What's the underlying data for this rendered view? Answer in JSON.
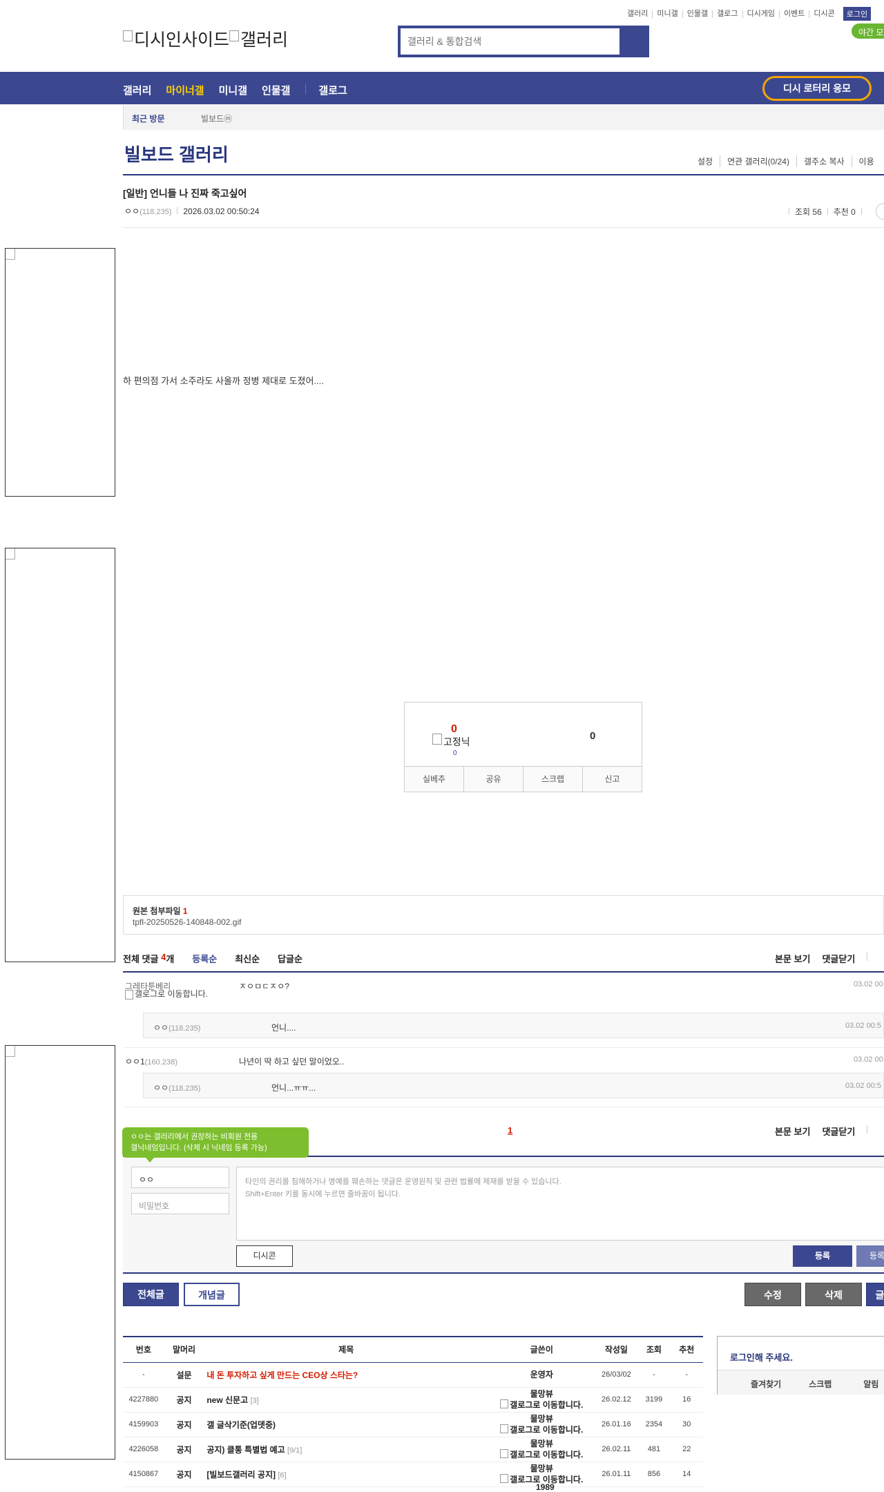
{
  "util_nav": [
    "갤러리",
    "미니갤",
    "인물갤",
    "갤로그",
    "디시게임",
    "이벤트",
    "디시콘"
  ],
  "login_label": "로그인",
  "night_mode_label": "야간 모",
  "logo_alt": "디시인사이드",
  "logo_gallery_alt": "갤러리",
  "search_placeholder": "갤러리 & 통합검색",
  "gnb": [
    "갤러리",
    "마이너갤",
    "미니갤",
    "인물갤"
  ],
  "gnb_gallog": "갤로그",
  "lotto_label": "디시 로터리 응모",
  "recent_visit_label": "최근 방문",
  "recent_gallery": "빌보드ⓜ",
  "gallery_title": "빌보드 갤러리",
  "gallery_menu": [
    "설정",
    "연관 갤러리(0/24)",
    "갤주소 복사",
    "이용"
  ],
  "post": {
    "title": "[일반] 언니들 나 진짜 죽고싶어",
    "writer": "ㅇㅇ",
    "writer_ip": "(118.235)",
    "date": "2026.03.02 00:50:24",
    "views": "조회 56",
    "recommend": "추천 0",
    "body": "하 편의점 가서 소주라도 사올까 정병 제대로 도졌어...."
  },
  "recommend_box": {
    "up": "0",
    "fixed_alt": "고정닉",
    "fixed_count": "0",
    "down": "0",
    "buttons": [
      "실베추",
      "공유",
      "스크랩",
      "신고"
    ]
  },
  "attachment": {
    "label": "원본 첨부파일",
    "count": "1",
    "file": "tpfl-20250526-140848-002.gif"
  },
  "comments_header": {
    "total_label": "전체 댓글",
    "count": "4",
    "unit": "개",
    "sort": [
      "등록순",
      "최신순",
      "답글순"
    ],
    "right": [
      "본문 보기",
      "댓글닫기"
    ]
  },
  "comments": [
    {
      "nick": "그레타툰베리",
      "gallog_alt": "갤로그로 이동합니다.",
      "text": "ㅈㅇㅁㄷㅈㅇ?",
      "date": "03.02 00"
    },
    {
      "nick": "ㅇㅇ",
      "ip": "(118.235)",
      "text": "언니....",
      "date": "03.02 00:5",
      "reply": true
    },
    {
      "nick": "ㅇㅇ1",
      "ip": "(160.238)",
      "text": "나년이 딱 하고 싶던 말이었오..",
      "date": "03.02 00"
    },
    {
      "nick": "ㅇㅇ",
      "ip": "(118.235)",
      "text": "언니...ㅠㅠ...",
      "date": "03.02 00:5",
      "reply": true
    }
  ],
  "page_number": "1",
  "write": {
    "tip": "ㅇㅇ는 갤러리에서 권장하는 비회원 전용\n갤닉네임입니다. (삭제 시 닉네임 등록 가능)",
    "name_value": "ㅇㅇ",
    "password_placeholder": "비밀번호",
    "textarea_placeholder": "타인의 권리를 침해하거나 명예를 훼손하는 댓글은 운영원칙 및 관련 법률에 제재를 받을 수 있습니다.\nShift+Enter 키를 동시에 누르면 줄바꿈이 됩니다.",
    "dccon_label": "디시콘",
    "submit_label": "등록",
    "submit2_label": "등록"
  },
  "list_tabs": [
    "전체글",
    "개념글"
  ],
  "action_buttons": [
    "수정",
    "삭제",
    "글"
  ],
  "table": {
    "headers": [
      "번호",
      "말머리",
      "제목",
      "글쓴이",
      "작성일",
      "조회",
      "추천"
    ],
    "rows": [
      {
        "no": "-",
        "head": "설문",
        "title": "내 돈 투자하고 싶게 만드는 CEO상 스타는?",
        "cnt": "",
        "writer": "운영자",
        "gallog": "",
        "date": "26/03/02",
        "views": "-",
        "rec": "-",
        "red": true
      },
      {
        "no": "4227880",
        "head": "공지",
        "title": "new 신문고",
        "cnt": "[3]",
        "writer": "물망뷰",
        "gallog": "갤로그로 이동합니다.",
        "date": "26.02.12",
        "views": "3199",
        "rec": "16"
      },
      {
        "no": "4159903",
        "head": "공지",
        "title": "갤 글삭기준(업뎃중)",
        "cnt": "",
        "writer": "물망뷰",
        "gallog": "갤로그로 이동합니다.",
        "date": "26.01.16",
        "views": "2354",
        "rec": "30"
      },
      {
        "no": "4226058",
        "head": "공지",
        "title": "공지) 클통 특별법 예고",
        "cnt": "[9/1]",
        "writer": "물망뷰",
        "gallog": "갤로그로 이동합니다.",
        "date": "26.02.11",
        "views": "481",
        "rec": "22"
      },
      {
        "no": "4150867",
        "head": "공지",
        "title": "[빌보드갤러리 공지]",
        "cnt": "[6]",
        "writer": "물망뷰",
        "gallog": "갤로그로 이동합니다.",
        "date": "26.01.11",
        "views": "856",
        "rec": "14"
      }
    ],
    "last_partial_writer": "1989"
  },
  "login_box": {
    "title": "로그인해 주세요.",
    "links": [
      "즐겨찾기",
      "스크랩",
      "알림"
    ]
  }
}
